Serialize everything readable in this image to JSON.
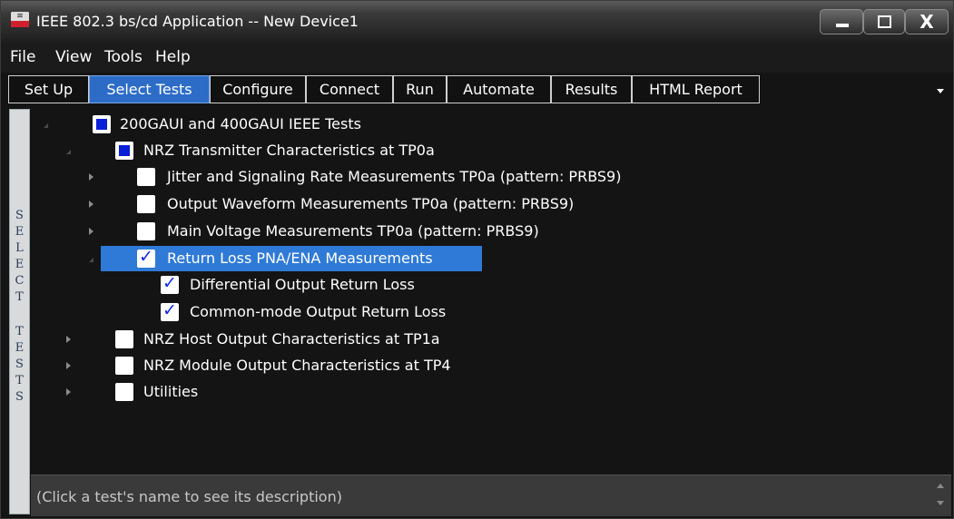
{
  "window": {
    "title": "IEEE 802.3 bs/cd Application -- New Device1",
    "close_glyph": "X"
  },
  "menu": [
    "File",
    "View",
    "Tools",
    "Help"
  ],
  "tabs": [
    {
      "label": "Set Up",
      "active": false
    },
    {
      "label": "Select Tests",
      "active": true
    },
    {
      "label": "Configure",
      "active": false
    },
    {
      "label": "Connect",
      "active": false
    },
    {
      "label": "Run",
      "active": false
    },
    {
      "label": "Automate",
      "active": false
    },
    {
      "label": "Results",
      "active": false
    },
    {
      "label": "HTML Report",
      "active": false
    }
  ],
  "side_panel": {
    "label_letters": [
      "S",
      "E",
      "L",
      "E",
      "C",
      "T",
      "",
      "T",
      "E",
      "S",
      "T",
      "S"
    ]
  },
  "tree": [
    {
      "label": "200GAUI and 400GAUI IEEE Tests",
      "state": "partial",
      "expander": "expanded"
    },
    {
      "label": "NRZ Transmitter Characteristics at TP0a",
      "state": "partial",
      "expander": "expanded"
    },
    {
      "label": "Jitter and Signaling Rate Measurements TP0a (pattern: PRBS9)",
      "state": "unchecked",
      "expander": "collapsed"
    },
    {
      "label": "Output Waveform Measurements TP0a (pattern: PRBS9)",
      "state": "unchecked",
      "expander": "collapsed"
    },
    {
      "label": "Main Voltage Measurements TP0a (pattern: PRBS9)",
      "state": "unchecked",
      "expander": "collapsed"
    },
    {
      "label": "Return Loss PNA/ENA Measurements",
      "state": "checked",
      "expander": "expanded",
      "selected": true
    },
    {
      "label": "Differential Output Return Loss",
      "state": "checked",
      "expander": "none"
    },
    {
      "label": "Common-mode Output Return Loss",
      "state": "checked",
      "expander": "none"
    },
    {
      "label": "NRZ Host Output Characteristics at TP1a",
      "state": "unchecked",
      "expander": "collapsed"
    },
    {
      "label": "NRZ Module Output Characteristics at TP4",
      "state": "unchecked",
      "expander": "collapsed"
    },
    {
      "label": "Utilities",
      "state": "unchecked",
      "expander": "collapsed"
    }
  ],
  "description": {
    "text": "(Click a test's name to see its description)"
  },
  "colors": {
    "selected_tab": "#2c6cc7",
    "selection_highlight": "#2f7ad6",
    "checkbox_mark": "#0a1fd8"
  },
  "icons": {
    "app": "app-logo-icon",
    "check": "✓"
  }
}
